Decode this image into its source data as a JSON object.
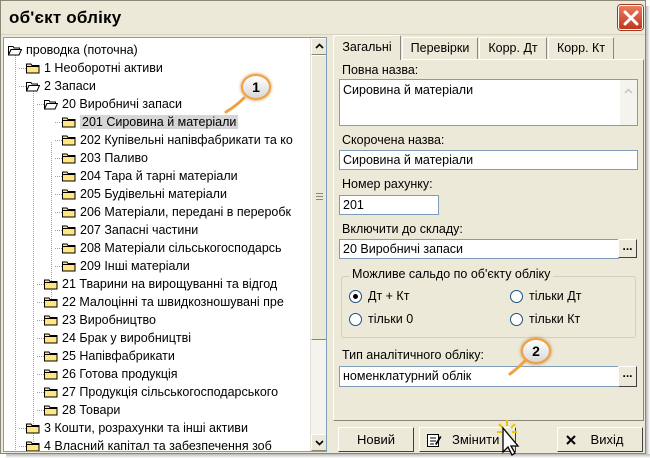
{
  "window": {
    "title": "об'єкт обліку"
  },
  "tree": {
    "items": [
      {
        "label": "проводка (поточна)",
        "level": 0,
        "open": true
      },
      {
        "label": "1 Необоротні активи",
        "level": 1,
        "open": false
      },
      {
        "label": "2 Запаси",
        "level": 1,
        "open": true
      },
      {
        "label": "20 Виробничі запаси",
        "level": 2,
        "open": true
      },
      {
        "label": "201 Сировина й матеріали",
        "level": 3,
        "open": false,
        "selected": true
      },
      {
        "label": "202 Купівельні напівфабрикати та ко",
        "level": 3,
        "open": false
      },
      {
        "label": "203 Паливо",
        "level": 3,
        "open": false
      },
      {
        "label": "204 Тара й тарні матеріали",
        "level": 3,
        "open": false
      },
      {
        "label": "205 Будівельні матеріали",
        "level": 3,
        "open": false
      },
      {
        "label": "206 Матеріали, передані в переробк",
        "level": 3,
        "open": false
      },
      {
        "label": "207 Запасні частини",
        "level": 3,
        "open": false
      },
      {
        "label": "208 Матеріали сільськогосподарсь",
        "level": 3,
        "open": false
      },
      {
        "label": "209 Інші матеріали",
        "level": 3,
        "open": false
      },
      {
        "label": "21 Тварини на вирощуванні та відгод",
        "level": 2,
        "open": false
      },
      {
        "label": "22 Малоцінні та швидкозношувані пре",
        "level": 2,
        "open": false
      },
      {
        "label": "23 Виробництво",
        "level": 2,
        "open": false
      },
      {
        "label": "24 Брак у виробництві",
        "level": 2,
        "open": false
      },
      {
        "label": "25 Напівфабрикати",
        "level": 2,
        "open": false
      },
      {
        "label": "26 Готова продукція",
        "level": 2,
        "open": false
      },
      {
        "label": "27 Продукція сільськогосподарського",
        "level": 2,
        "open": false
      },
      {
        "label": "28 Товари",
        "level": 2,
        "open": false
      },
      {
        "label": "3 Кошти, розрахунки та інші активи",
        "level": 1,
        "open": false
      },
      {
        "label": "4 Власний капітал та забезпечення зоб",
        "level": 1,
        "open": false
      }
    ]
  },
  "tabs": [
    {
      "label": "Загальні",
      "active": true
    },
    {
      "label": "Перевірки",
      "active": false
    },
    {
      "label": "Корр. Дт",
      "active": false
    },
    {
      "label": "Корр. Кт",
      "active": false
    }
  ],
  "form": {
    "full_name_label": "Повна назва:",
    "full_name_value": "Сировина й матеріали",
    "short_name_label": "Скорочена назва:",
    "short_name_value": "Сировина й матеріали",
    "account_number_label": "Номер рахунку:",
    "account_number_value": "201",
    "include_label": "Включити до складу:",
    "include_value": "20 Виробничі запаси",
    "dots": "...",
    "balance_group_title": "Можливе сальдо по об'єкту обліку",
    "radios": [
      {
        "label": "Дт + Кт",
        "checked": true
      },
      {
        "label": "тільки Дт",
        "checked": false
      },
      {
        "label": "тільки 0",
        "checked": false
      },
      {
        "label": "тільки Кт",
        "checked": false
      }
    ],
    "analytics_label": "Тип аналітичного обліку:",
    "analytics_value": "номенклатурний облік"
  },
  "buttons": {
    "new": "Новий",
    "edit": "Змінити",
    "exit": "Вихід"
  },
  "callouts": [
    "1",
    "2"
  ]
}
